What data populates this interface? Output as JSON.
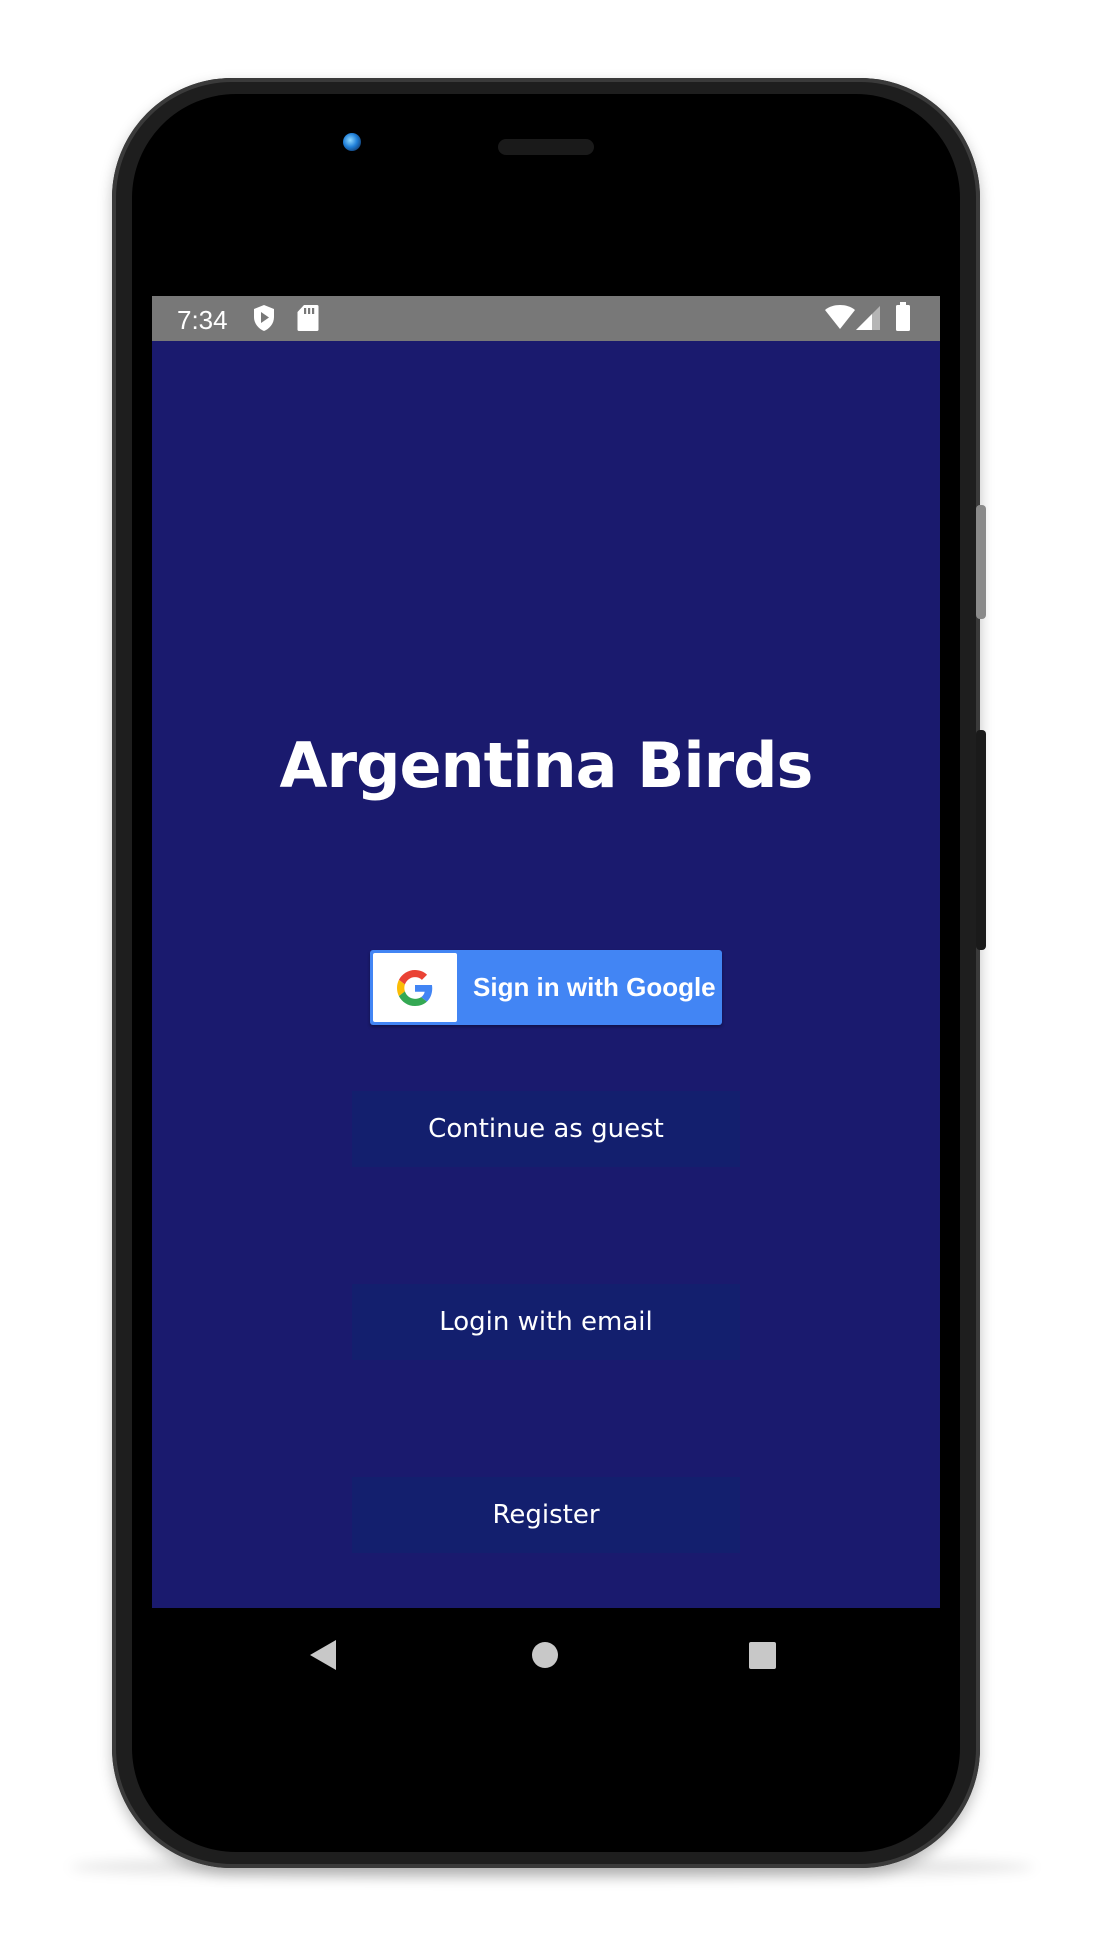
{
  "status_bar": {
    "time": "7:34",
    "left_icons": [
      "shield-play-icon",
      "sd-card-icon"
    ],
    "right_icons": [
      "wifi-icon",
      "cell-signal-icon",
      "battery-icon"
    ],
    "background": "#787878"
  },
  "app": {
    "title": "Argentina Birds",
    "background": "#1a1a6e"
  },
  "buttons": {
    "google_sign_in": "Sign in with Google",
    "continue_guest": "Continue as guest",
    "login_email": "Login with email",
    "register": "Register"
  },
  "colors": {
    "google_blue": "#4285f4",
    "flat_button": "#131f6e"
  },
  "navigation_bar": {
    "buttons": [
      "back-icon",
      "home-icon",
      "recents-icon"
    ]
  }
}
